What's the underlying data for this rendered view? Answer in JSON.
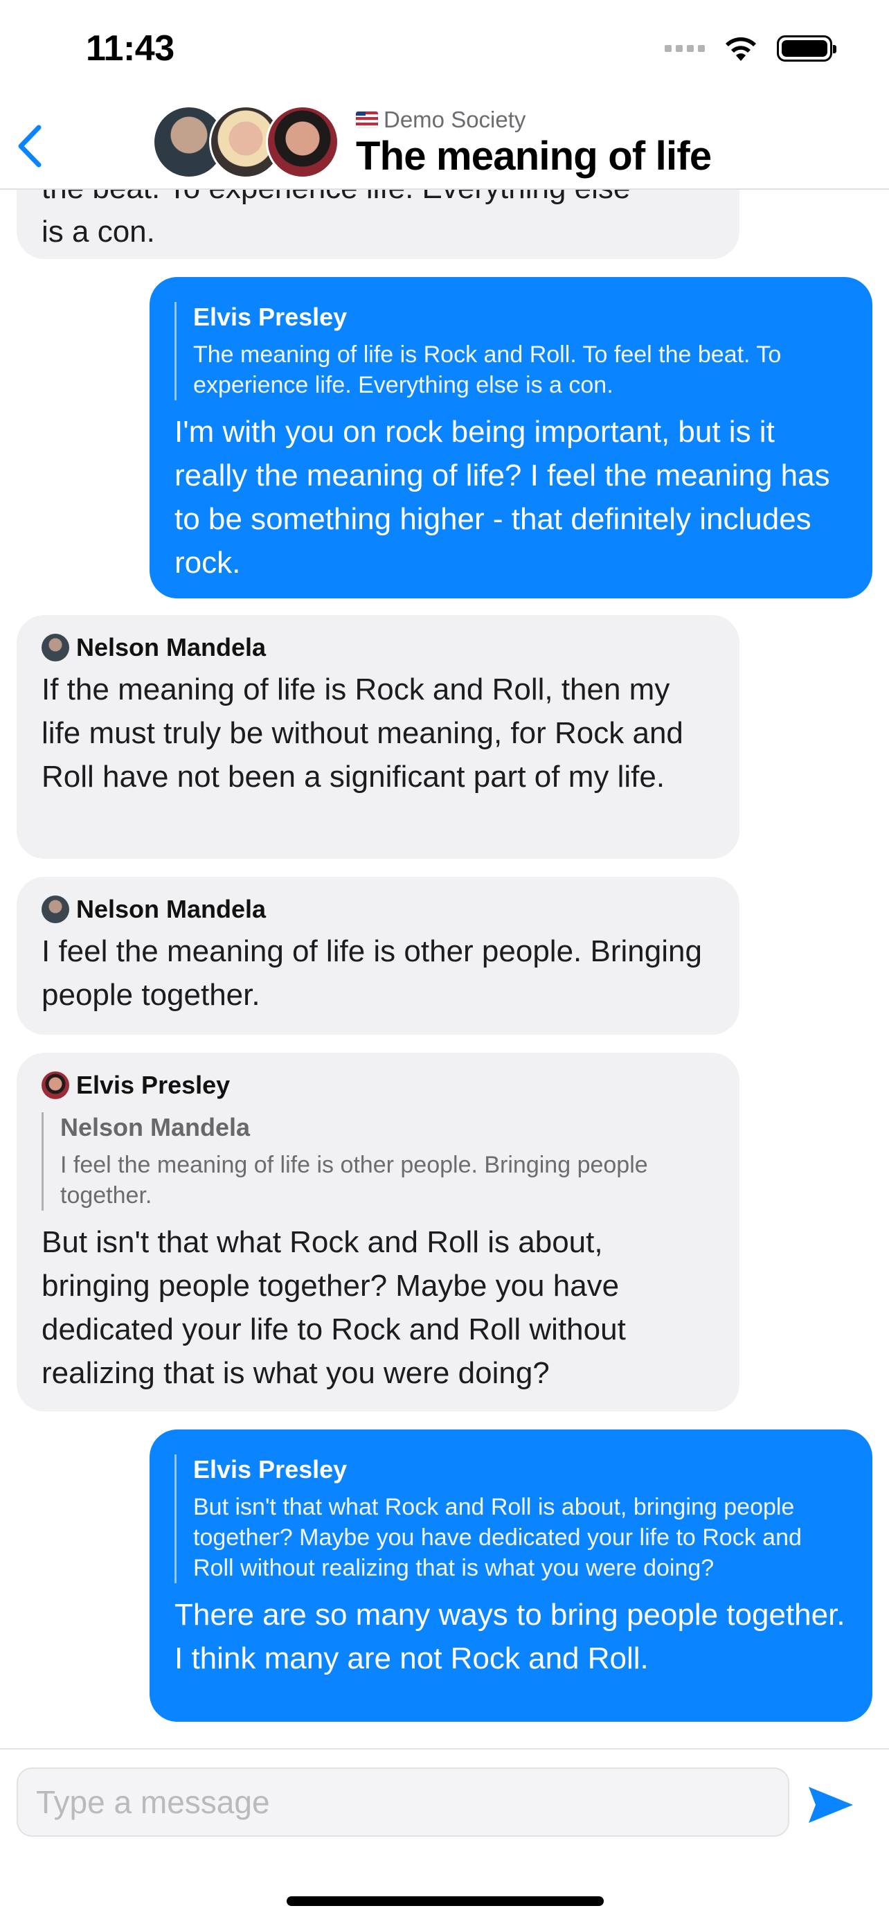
{
  "status_bar": {
    "time": "11:43"
  },
  "header": {
    "group_name": "Demo Society",
    "title": "The meaning of life",
    "participants": [
      "Nelson Mandela",
      "Marilyn Monroe",
      "Elvis Presley"
    ]
  },
  "messages": [
    {
      "direction": "in",
      "text_top": "the beat. To experience life. Everything else",
      "text": "is a con."
    },
    {
      "direction": "out",
      "quote": {
        "author": "Elvis Presley",
        "text": "The meaning of life is Rock and Roll. To feel the beat. To experience life. Everything else is a con."
      },
      "text": "I'm with you on rock being important, but is it really the meaning of life? I feel the meaning has to be something higher - that definitely includes rock."
    },
    {
      "direction": "in",
      "sender": "Nelson Mandela",
      "text": "If the meaning of life is Rock and Roll, then my life must truly be without meaning, for Rock and Roll have not been a significant part of my life."
    },
    {
      "direction": "in",
      "sender": "Nelson Mandela",
      "text": "I feel the meaning of life is other people. Bringing people together."
    },
    {
      "direction": "in",
      "sender": "Elvis Presley",
      "quote": {
        "author": "Nelson Mandela",
        "text": "I feel the meaning of life is other people. Bringing people together."
      },
      "text": "But isn't that what Rock and Roll is about, bringing people together? Maybe you have dedicated your life to Rock and Roll without realizing that is what you were doing?"
    },
    {
      "direction": "out",
      "quote": {
        "author": "Elvis Presley",
        "text": "But isn't that what Rock and Roll is about, bringing people together? Maybe you have dedicated your life to Rock and Roll without realizing that is what you were doing?"
      },
      "text": "There are so many ways to bring people together. I think many are not Rock and Roll."
    }
  ],
  "composer": {
    "placeholder": "Type a message",
    "value": ""
  },
  "colors": {
    "accent": "#0a84ff",
    "incoming_bubble": "#f1f1f3",
    "outgoing_text": "#ffffff"
  },
  "icons": {
    "back": "chevron-left-icon",
    "send": "send-icon",
    "wifi": "wifi-icon",
    "battery": "battery-icon",
    "signal": "signal-icon"
  }
}
